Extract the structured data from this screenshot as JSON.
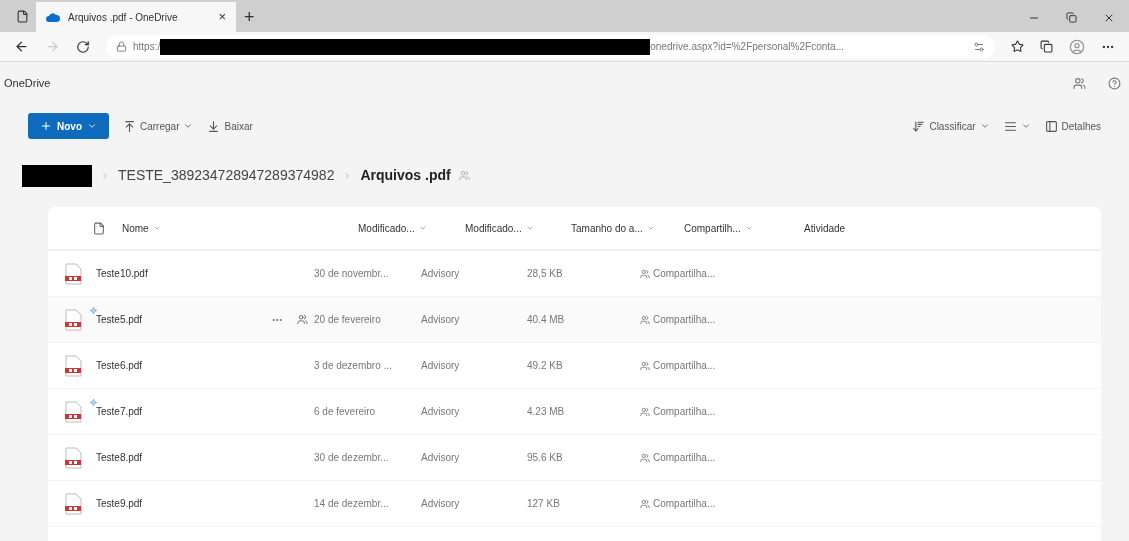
{
  "browser": {
    "tab_title": "Arquivos .pdf - OneDrive",
    "tab_close": "×",
    "new_tab": "+",
    "url_start": "https:/",
    "url_end": "onedrive.aspx?id=%2Fpersonal%2Fconta..."
  },
  "app": {
    "title": "OneDrive"
  },
  "toolbar": {
    "new": "Novo",
    "upload": "Carregar",
    "download": "Baixar",
    "sort": "Classificar",
    "details": "Detalhes"
  },
  "breadcrumb": [
    {
      "label": "TESTE_389234728947289374982",
      "current": false
    },
    {
      "label": "Arquivos .pdf",
      "current": true
    }
  ],
  "table": {
    "columns": [
      "Nome",
      "Modificado...",
      "Modificado...",
      "Tamanho do a...",
      "Compartilh...",
      "Atividade"
    ],
    "rows": [
      {
        "name": "Teste10.pdf",
        "new": false,
        "hovered": false,
        "modified": "30 de novembr...",
        "modified_by": "Advisory",
        "size": "28,5 KB",
        "sharing": "Compartilha..."
      },
      {
        "name": "Teste5.pdf",
        "new": true,
        "hovered": true,
        "modified": "20 de fevereiro",
        "modified_by": "Advisory",
        "size": "40.4 MB",
        "sharing": "Compartilha..."
      },
      {
        "name": "Teste6.pdf",
        "new": false,
        "hovered": false,
        "modified": "3 de dezembro ...",
        "modified_by": "Advisory",
        "size": "49.2 KB",
        "sharing": "Compartilha..."
      },
      {
        "name": "Teste7.pdf",
        "new": true,
        "hovered": false,
        "modified": "6 de fevereiro",
        "modified_by": "Advisory",
        "size": "4.23 MB",
        "sharing": "Compartilha..."
      },
      {
        "name": "Teste8.pdf",
        "new": false,
        "hovered": false,
        "modified": "30 de dezembr...",
        "modified_by": "Advisory",
        "size": "95.6 KB",
        "sharing": "Compartilha..."
      },
      {
        "name": "Teste9.pdf",
        "new": false,
        "hovered": false,
        "modified": "14 de dezembr...",
        "modified_by": "Advisory",
        "size": "127 KB",
        "sharing": "Compartilha..."
      }
    ]
  }
}
